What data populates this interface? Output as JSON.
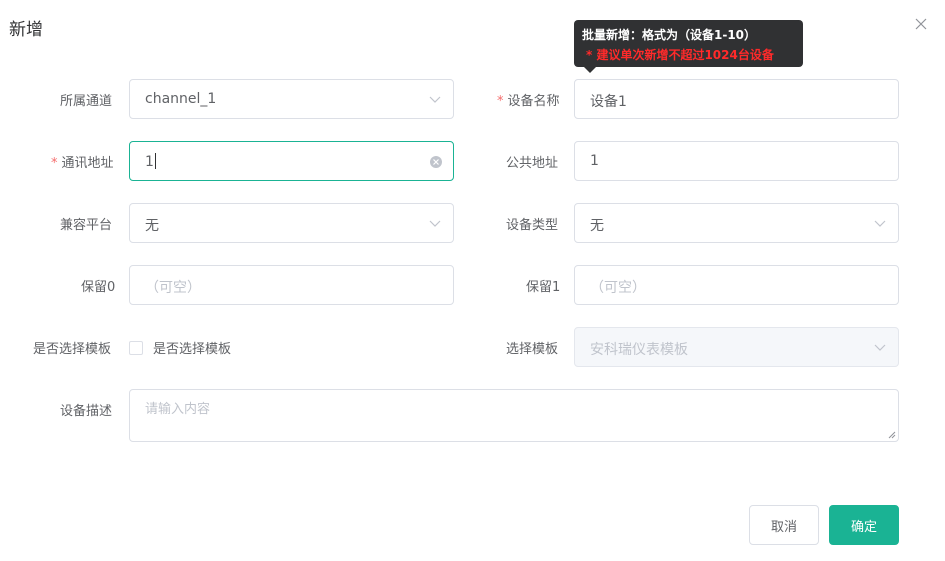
{
  "dialog": {
    "title": "新增"
  },
  "tooltip": {
    "line1": "批量新增：格式为（设备1-10）",
    "line2": "* 建议单次新增不超过1024台设备"
  },
  "form": {
    "channel": {
      "label": "所属通道",
      "value": "channel_1"
    },
    "device_name": {
      "required": "*",
      "label": "设备名称",
      "value": "设备1"
    },
    "comm_address": {
      "required": "*",
      "label": "通讯地址",
      "value": "1"
    },
    "public_address": {
      "label": "公共地址",
      "value": "1"
    },
    "platform": {
      "label": "兼容平台",
      "value": "无"
    },
    "device_type": {
      "label": "设备类型",
      "value": "无"
    },
    "reserved0": {
      "label": "保留0",
      "placeholder": "（可空）"
    },
    "reserved1": {
      "label": "保留1",
      "placeholder": "（可空）"
    },
    "use_template": {
      "label": "是否选择模板",
      "checkbox_label": "是否选择模板",
      "checked": false
    },
    "template": {
      "label": "选择模板",
      "value": "安科瑞仪表模板"
    },
    "description": {
      "label": "设备描述",
      "placeholder": "请输入内容"
    }
  },
  "buttons": {
    "cancel": "取消",
    "confirm": "确定"
  },
  "colors": {
    "primary": "#1ab394",
    "required": "#f56c6c",
    "tooltip_bg": "#303133",
    "tooltip_warning": "#ff2a2a"
  }
}
